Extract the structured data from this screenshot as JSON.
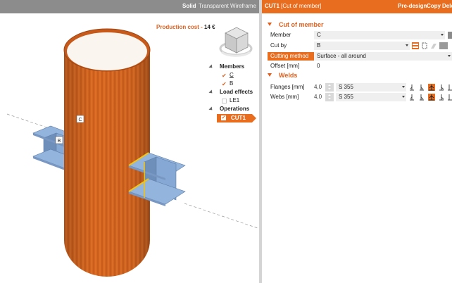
{
  "viewport": {
    "modes": [
      "Solid",
      "Transparent",
      "Wireframe"
    ],
    "active_mode": "Solid",
    "production_cost_label": "Production cost",
    "production_cost_value": "14 €",
    "labels": {
      "column": "C",
      "beam": "B"
    }
  },
  "tree": {
    "members_head": "Members",
    "members": [
      "C",
      "B"
    ],
    "load_effects_head": "Load effects",
    "load_effects": [
      "LE1"
    ],
    "operations_head": "Operations",
    "operations": [
      "CUT1"
    ]
  },
  "panel": {
    "title_id": "CUT1",
    "title_desc": "[Cut of member]",
    "actions": [
      "Pre-design",
      "Copy",
      "Dele"
    ],
    "cut_section": "Cut of member",
    "member_label": "Member",
    "member_value": "C",
    "cutby_label": "Cut by",
    "cutby_value": "B",
    "method_label": "Cutting method",
    "method_value": "Surface - all around",
    "offset_label": "Offset [mm]",
    "offset_value": "0",
    "welds_section": "Welds",
    "welds": [
      {
        "label": "Flanges [mm]",
        "size": "4,0",
        "material": "S 355"
      },
      {
        "label": "Webs [mm]",
        "size": "4,0",
        "material": "S 355"
      }
    ]
  },
  "colors": {
    "accent": "#e96d1f",
    "member_orange": "#d4641d",
    "beam_blue": "#8eb0da"
  },
  "icons": [
    "dropdown-caret",
    "spinner",
    "weld-fillet",
    "weld-butt",
    "weld-double",
    "cut-surface",
    "cut-box"
  ]
}
